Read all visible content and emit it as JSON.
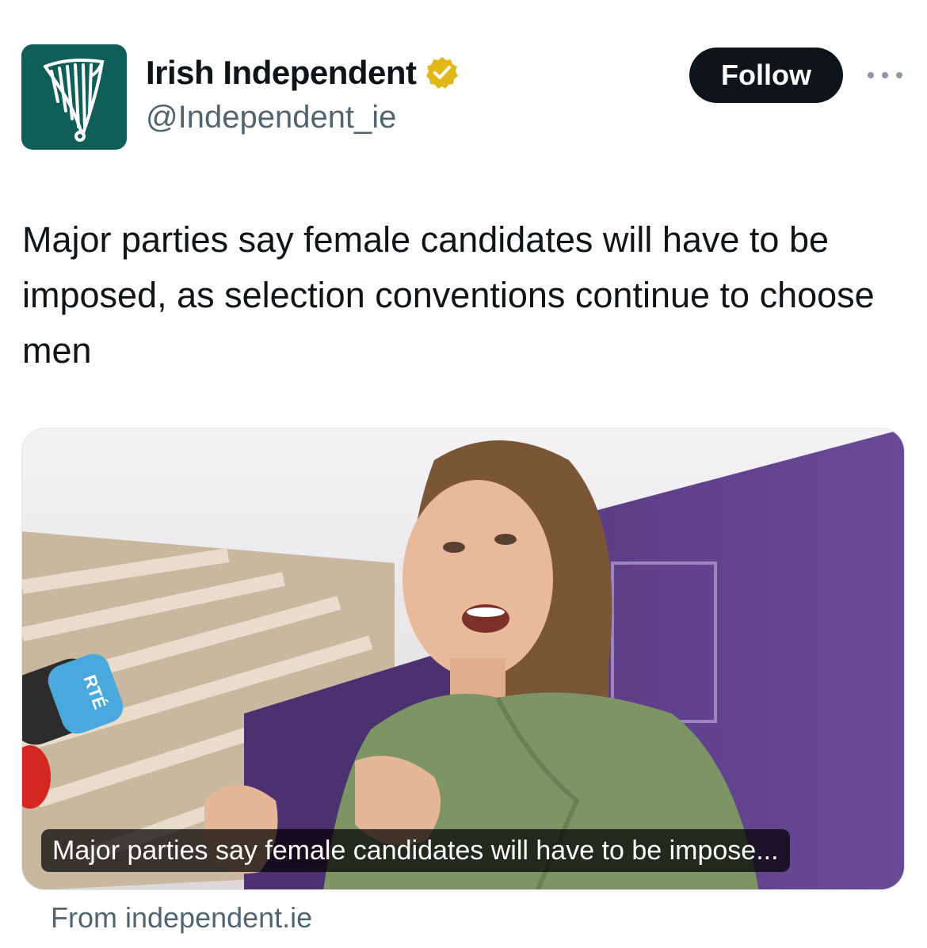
{
  "account": {
    "display_name": "Irish Independent",
    "handle": "@Independent_ie",
    "avatar_icon": "harp-logo-icon",
    "verified_icon": "gold-verified-badge-icon"
  },
  "actions": {
    "follow_label": "Follow",
    "more_icon": "more-dots-icon"
  },
  "tweet": {
    "text": "Major parties say female candidates will have to be imposed, as selection conventions continue to choose men"
  },
  "card": {
    "caption": "Major parties say female candidates will have to be impose...",
    "source": "From independent.ie",
    "mic_label": "RTÉ"
  },
  "colors": {
    "brand_green": "#0f5f58",
    "verified_gold": "#e2b719",
    "follow_bg": "#0f1419",
    "secondary_text": "#536471"
  }
}
